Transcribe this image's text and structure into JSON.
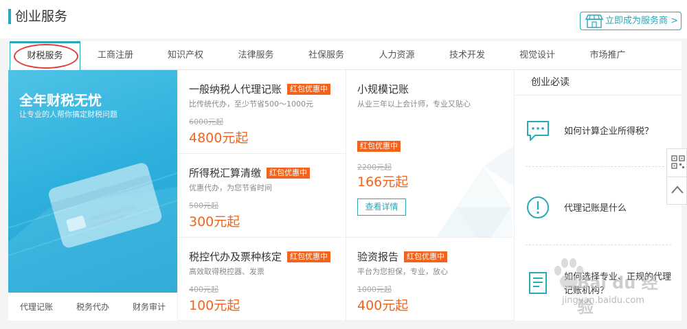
{
  "header": {
    "title": "创业服务",
    "become_provider": "立即成为服务商 >"
  },
  "tabs": [
    {
      "label": "财税服务",
      "active": true
    },
    {
      "label": "工商注册"
    },
    {
      "label": "知识产权"
    },
    {
      "label": "法律服务"
    },
    {
      "label": "社保服务"
    },
    {
      "label": "人力资源"
    },
    {
      "label": "技术开发"
    },
    {
      "label": "视觉设计"
    },
    {
      "label": "市场推广"
    }
  ],
  "promo": {
    "title": "全年财税无忧",
    "subtitle": "让专业的人帮你搞定财税问题",
    "links": [
      "代理记账",
      "税务代办",
      "财务审计"
    ]
  },
  "badge_label": "红包优惠中",
  "products": [
    {
      "name": "一般纳税人代理记账",
      "desc": "比传统代办，至少节省500～1000元",
      "old_price": "6000元起",
      "price": "4800元起"
    },
    {
      "name": "所得税汇算清缴",
      "desc": "优惠代办，为您节省时间",
      "old_price": "500元起",
      "price": "300元起"
    },
    {
      "name": "税控代办及票种核定",
      "desc": "高效取得税控器、发票",
      "old_price": "400元起",
      "price": "100元起"
    },
    {
      "name": "小规模记账",
      "desc": "从业三年以上会计师，专业又贴心",
      "old_price": "2200元起",
      "price": "166元起",
      "detail_button": "查看详情"
    },
    {
      "name": "验资报告",
      "desc": "平台为您担保，专业，放心",
      "old_price": "1000元起",
      "price": "400元起"
    }
  ],
  "reading": {
    "title": "创业必读",
    "items": [
      {
        "text": "如何计算企业所得税？",
        "icon": "chat-bubble-icon"
      },
      {
        "text": "代理记账是什么",
        "icon": "exclamation-circle-icon"
      },
      {
        "text": "如何选择专业、正规的代理记账机构？",
        "icon": "document-icon"
      }
    ]
  },
  "watermark": {
    "brand": "Bai du 经验",
    "url": "jingyan.baidu.com"
  },
  "colors": {
    "accent": "#27a9b9",
    "price": "#f0641d",
    "badge": "#f0641d",
    "annotation": "#e23b3b"
  }
}
